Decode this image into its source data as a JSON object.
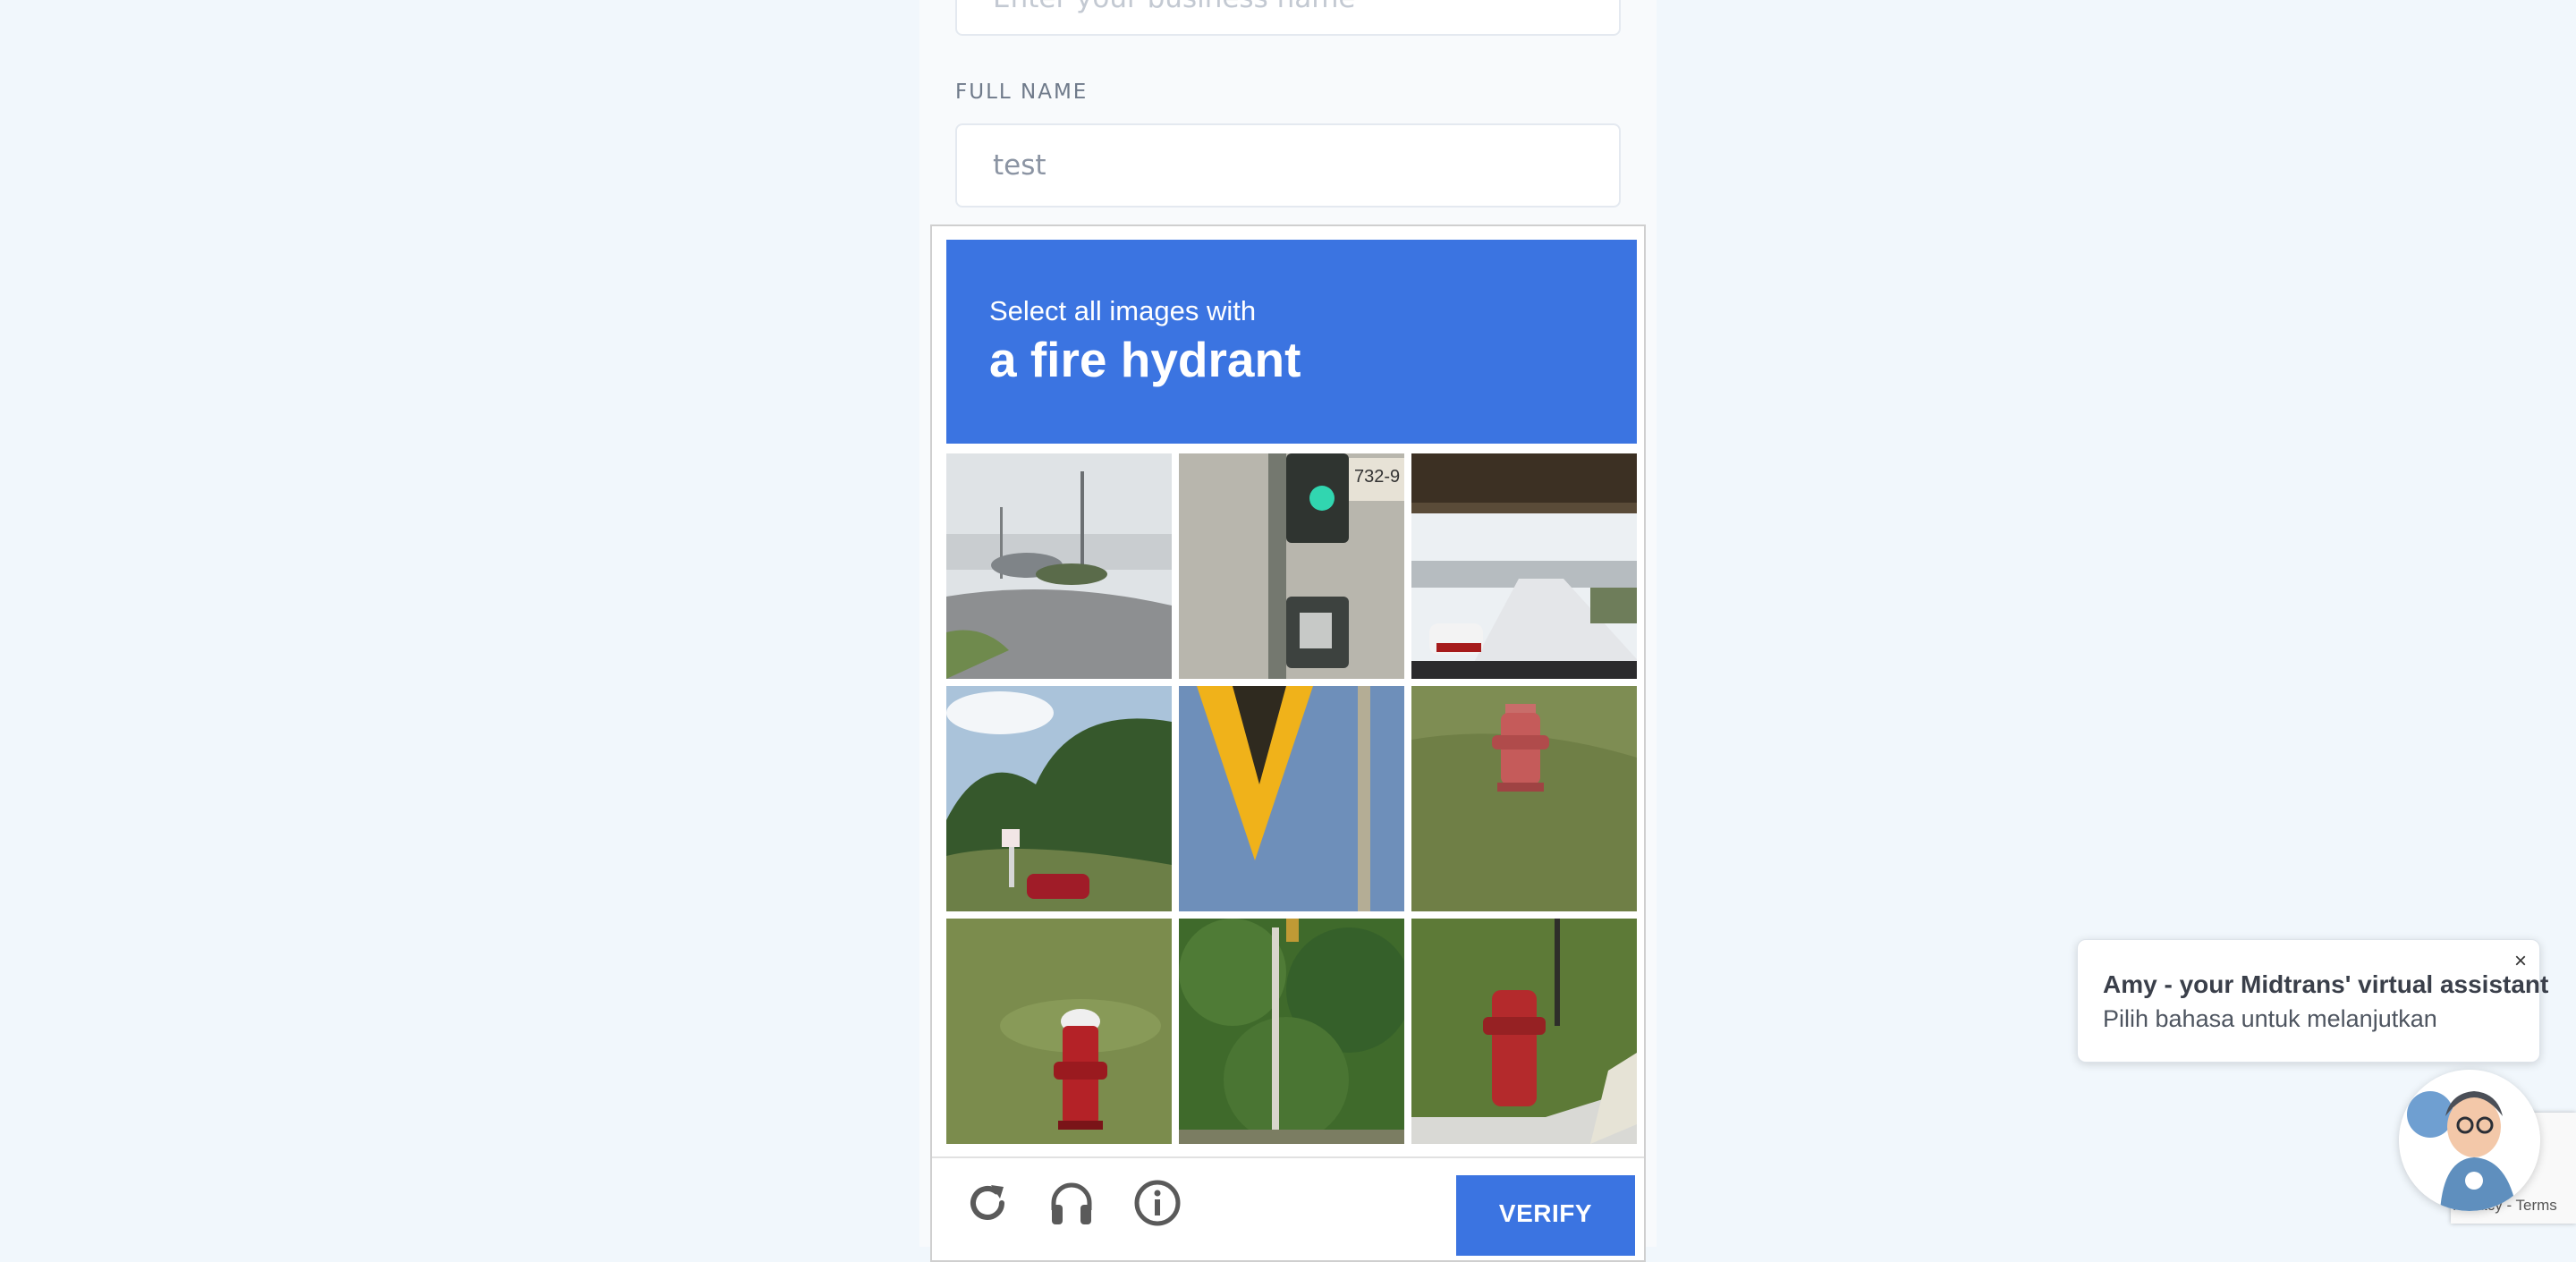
{
  "form": {
    "business_placeholder": "Enter your business name",
    "full_name_label": "FULL NAME",
    "full_name_value": "test"
  },
  "captcha": {
    "instruction": "Select all images with",
    "target": "a fire hydrant",
    "tiles": [
      {
        "scene": "parking lot with cars"
      },
      {
        "scene": "traffic light on pole"
      },
      {
        "scene": "highway under overpass"
      },
      {
        "scene": "trees and red car"
      },
      {
        "scene": "yellow sign against sky"
      },
      {
        "scene": "red fire hydrant on grass"
      },
      {
        "scene": "red fire hydrant with white cap"
      },
      {
        "scene": "tree and lamp pole"
      },
      {
        "scene": "red fire hydrant near curb"
      }
    ],
    "verify_label": "VERIFY",
    "reload_icon": "reload-icon",
    "audio_icon": "headphones-icon",
    "info_icon": "info-icon"
  },
  "assistant": {
    "title": "Amy - your Midtrans' virtual assistant",
    "subtitle": "Pilih bahasa untuk melanjutkan",
    "close_label": "×"
  },
  "recaptcha": {
    "terms": "Privacy - Terms"
  },
  "colors": {
    "accent": "#3b74e1",
    "page_bg": "#f1f7fc"
  }
}
